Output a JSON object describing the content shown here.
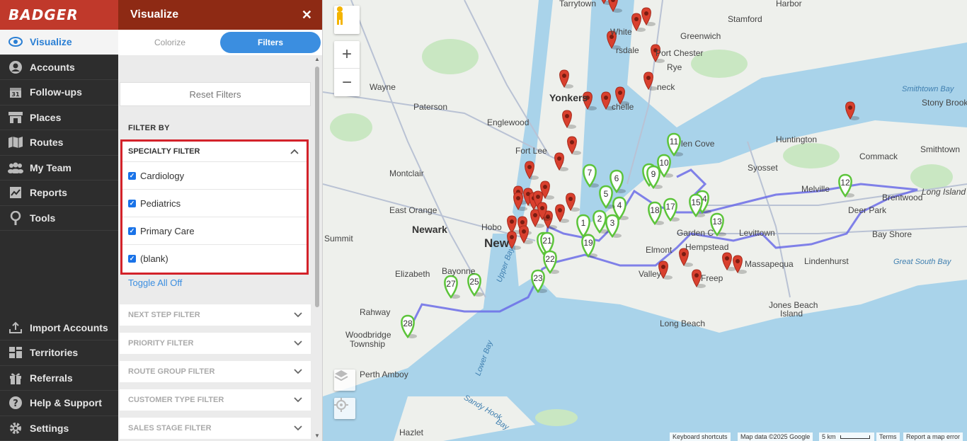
{
  "brand": "BADGER",
  "nav": {
    "items": [
      {
        "label": "Visualize",
        "icon": "eye-icon",
        "active": true
      },
      {
        "label": "Accounts",
        "icon": "user-circle-icon"
      },
      {
        "label": "Follow-ups",
        "icon": "calendar-icon"
      },
      {
        "label": "Places",
        "icon": "storefront-icon"
      },
      {
        "label": "Routes",
        "icon": "map-icon"
      },
      {
        "label": "My Team",
        "icon": "team-icon"
      },
      {
        "label": "Reports",
        "icon": "report-icon"
      },
      {
        "label": "Tools",
        "icon": "tools-icon"
      }
    ],
    "bottom_items": [
      {
        "label": "Import Accounts",
        "icon": "upload-icon"
      },
      {
        "label": "Territories",
        "icon": "territories-icon"
      },
      {
        "label": "Referrals",
        "icon": "gift-icon"
      },
      {
        "label": "Help & Support",
        "icon": "help-icon"
      },
      {
        "label": "Settings",
        "icon": "gear-icon"
      }
    ]
  },
  "panel": {
    "title": "Visualize",
    "close": "✕",
    "tabs": [
      {
        "label": "Colorize"
      },
      {
        "label": "Filters",
        "active": true
      }
    ],
    "reset_label": "Reset Filters",
    "filter_by": "FILTER BY",
    "specialty": {
      "title": "SPECIALTY FILTER",
      "options": [
        {
          "label": "Cardiology",
          "checked": true
        },
        {
          "label": "Pediatrics",
          "checked": true
        },
        {
          "label": "Primary Care",
          "checked": true
        },
        {
          "label": "(blank)",
          "checked": true
        }
      ]
    },
    "toggle_all": "Toggle All Off",
    "accordions": [
      "NEXT STEP FILTER",
      "PRIORITY FILTER",
      "ROUTE GROUP FILTER",
      "CUSTOMER TYPE FILTER",
      "SALES STAGE FILTER"
    ]
  },
  "map": {
    "zoom_in": "+",
    "zoom_out": "−",
    "labels": {
      "tarrytown": "Tarrytown",
      "harbor": "Harbor",
      "stamford": "Stamford",
      "greenwich": "Greenwich",
      "white_plains": "White",
      "scarsdale": "rsdale",
      "port_chester": "Port Chester",
      "rye": "Rye",
      "wayne": "Wayne",
      "yonkers": "Yonkers",
      "paterson": "Paterson",
      "neck": "neck",
      "chelle": "chelle",
      "smithtown_bay": "Smithtown Bay",
      "stony_brook": "Stony Brook",
      "englewood": "Englewood",
      "huntington": "Huntington",
      "fort_lee": "Fort Lee",
      "glen_cove": "len Cove",
      "syosset": "Syosset",
      "commack": "Commack",
      "smithtown": "Smithtown",
      "montclair": "Montclair",
      "melville": "Melville",
      "brentwood": "Brentwood",
      "long_island": "Long Island",
      "east_orange": "East Orange",
      "deer_park": "Deer Park",
      "newark": "Newark",
      "hobo": "Hobo",
      "garden_city": "Garden C",
      "levittown": "Levittown",
      "bay_shore": "Bay Shore",
      "summit": "Summit",
      "new_york": "New",
      "elmont": "Elmont",
      "hempstead": "Hempstead",
      "massapequa": "Massapequa",
      "lindenhurst": "Lindenhurst",
      "great_south_bay": "Great South Bay",
      "elizabeth": "Elizabeth",
      "bayonne": "Bayonne",
      "valley": "Valley",
      "freeport": "Freep",
      "upper_bay": "Upper Bay",
      "rahway": "Rahway",
      "jones_beach": "Jones Beach",
      "jones_beach_island": "Island",
      "long_beach": "Long Beach",
      "woodbridge": "Woodbridge",
      "woodbridge_township": "Township",
      "lower_bay": "Lower Bay",
      "perth_amboy": "Perth Amboy",
      "sandy_hook_bay": "Sandy Hook",
      "sandy_hook_bay_2": "Bay",
      "hazlet": "Hazlet"
    },
    "attribution": {
      "shortcuts": "Keyboard shortcuts",
      "data": "Map data ©2025 Google",
      "scale": "5 km",
      "terms": "Terms",
      "report": "Report a map error"
    },
    "green_markers": [
      "1",
      "2",
      "3",
      "4",
      "5",
      "6",
      "7",
      "9",
      "10",
      "11",
      "12",
      "13",
      "14",
      "15",
      "17",
      "18",
      "19",
      "21",
      "22",
      "23",
      "25",
      "27",
      "28"
    ],
    "colors": {
      "green": "#5cc43a",
      "red": "#d9402e",
      "route": "#6b6ce8",
      "water": "#a9d3ea",
      "land": "#eef0ec",
      "park": "#c9e7c2"
    }
  }
}
